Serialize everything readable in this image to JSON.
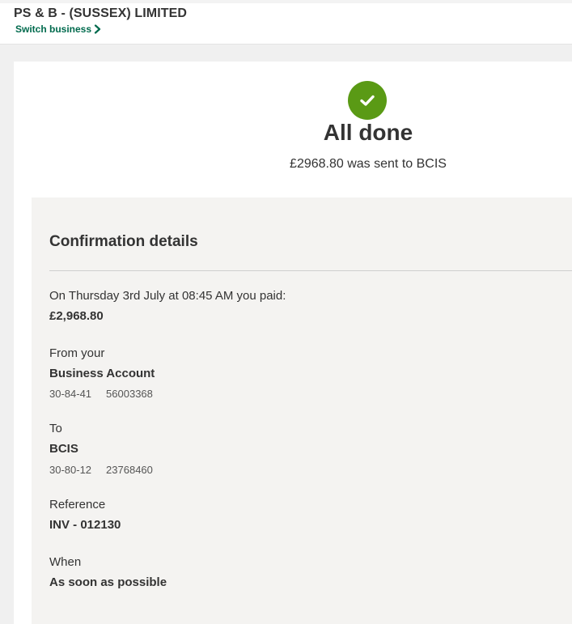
{
  "header": {
    "business_name": "PS & B - (SUSSEX) LIMITED",
    "switch_label": "Switch business"
  },
  "status": {
    "icon": "check-icon",
    "title": "All done",
    "subtitle": "£2968.80 was sent to BCIS",
    "accent_color": "#5a9a15",
    "link_color": "#006a4d"
  },
  "confirmation": {
    "heading": "Confirmation details",
    "paid": {
      "label": "On Thursday 3rd July at 08:45 AM you paid:",
      "value": "£2,968.80"
    },
    "from": {
      "label": "From your",
      "account_name": "Business Account",
      "sort_code": "30-84-41",
      "account_number": "56003368"
    },
    "to": {
      "label": "To",
      "payee_name": "BCIS",
      "sort_code": "30-80-12",
      "account_number": "23768460"
    },
    "reference": {
      "label": "Reference",
      "value": "INV - 012130"
    },
    "when": {
      "label": "When",
      "value": "As soon as possible"
    }
  }
}
